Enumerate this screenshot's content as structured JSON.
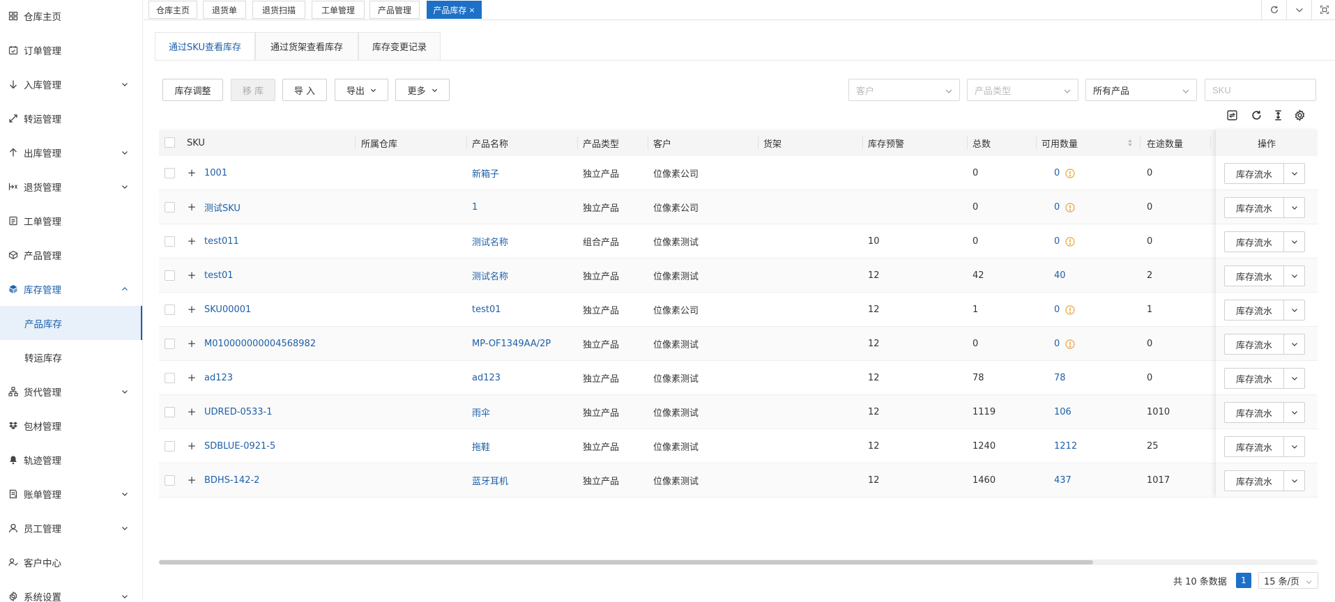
{
  "sidebar": {
    "items": [
      {
        "label": "仓库主页",
        "icon": "grid-icon",
        "chevron": false
      },
      {
        "label": "订单管理",
        "icon": "calendar-icon",
        "chevron": false
      },
      {
        "label": "入库管理",
        "icon": "arrow-down-icon",
        "chevron": true
      },
      {
        "label": "转运管理",
        "icon": "transfer-icon",
        "chevron": false
      },
      {
        "label": "出库管理",
        "icon": "arrow-up-icon",
        "chevron": true
      },
      {
        "label": "退货管理",
        "icon": "return-icon",
        "chevron": true
      },
      {
        "label": "工单管理",
        "icon": "ticket-icon",
        "chevron": false
      },
      {
        "label": "产品管理",
        "icon": "box-icon",
        "chevron": false
      },
      {
        "label": "库存管理",
        "icon": "inventory-icon",
        "chevron": true
      }
    ],
    "sub_items": [
      {
        "label": "产品库存"
      },
      {
        "label": "转运库存"
      }
    ],
    "items_after": [
      {
        "label": "货代管理",
        "icon": "hierarchy-icon",
        "chevron": true
      },
      {
        "label": "包材管理",
        "icon": "dropbox-icon",
        "chevron": false
      },
      {
        "label": "轨迹管理",
        "icon": "bell-icon",
        "chevron": false
      },
      {
        "label": "账单管理",
        "icon": "bill-icon",
        "chevron": true
      },
      {
        "label": "员工管理",
        "icon": "user-icon",
        "chevron": true
      },
      {
        "label": "客户中心",
        "icon": "customer-icon",
        "chevron": false
      },
      {
        "label": "系统设置",
        "icon": "settings-icon",
        "chevron": true
      }
    ]
  },
  "top_tabs": [
    "仓库主页",
    "退货单",
    "退货扫描",
    "工单管理",
    "产品管理",
    "产品库存"
  ],
  "top_tab_close": "×",
  "content_tabs": [
    "通过SKU查看库存",
    "通过货架查看库存",
    "库存变更记录"
  ],
  "toolbar": {
    "adjust": "库存调整",
    "move": "移 库",
    "import": "导 入",
    "export": "导出",
    "more": "更多"
  },
  "filters": {
    "customer": "客户",
    "product_type": "产品类型",
    "product_scope": "所有产品",
    "sku_placeholder": "SKU"
  },
  "table": {
    "headers": {
      "sku": "SKU",
      "warehouse": "所属仓库",
      "name": "产品名称",
      "type": "产品类型",
      "customer": "客户",
      "shelf": "货架",
      "warning": "库存预警",
      "total": "总数",
      "available": "可用数量",
      "transit": "在途数量",
      "op": "操作"
    },
    "rows": [
      {
        "sku": "1001",
        "warehouse": "",
        "name": "新箱子",
        "type": "独立产品",
        "customer": "位像素公司",
        "shelf": "",
        "warning": "",
        "total": "0",
        "available": "0",
        "available_warn": true,
        "transit": "0"
      },
      {
        "sku": "测试SKU",
        "warehouse": "",
        "name": "1",
        "type": "独立产品",
        "customer": "位像素公司",
        "shelf": "",
        "warning": "",
        "total": "0",
        "available": "0",
        "available_warn": true,
        "transit": "0"
      },
      {
        "sku": "test011",
        "warehouse": "",
        "name": "测试名称",
        "type": "组合产品",
        "customer": "位像素测试",
        "shelf": "",
        "warning": "10",
        "total": "0",
        "available": "0",
        "available_warn": true,
        "transit": "0"
      },
      {
        "sku": "test01",
        "warehouse": "",
        "name": "测试名称",
        "type": "独立产品",
        "customer": "位像素测试",
        "shelf": "",
        "warning": "12",
        "total": "42",
        "available": "40",
        "available_warn": false,
        "transit": "2"
      },
      {
        "sku": "SKU00001",
        "warehouse": "",
        "name": "test01",
        "type": "独立产品",
        "customer": "位像素公司",
        "shelf": "",
        "warning": "12",
        "total": "1",
        "available": "0",
        "available_warn": true,
        "transit": "1"
      },
      {
        "sku": "M010000000004568982",
        "warehouse": "",
        "name": "MP-OF1349AA/2P",
        "type": "独立产品",
        "customer": "位像素测试",
        "shelf": "",
        "warning": "12",
        "total": "0",
        "available": "0",
        "available_warn": true,
        "transit": "0"
      },
      {
        "sku": "ad123",
        "warehouse": "",
        "name": "ad123",
        "type": "独立产品",
        "customer": "位像素测试",
        "shelf": "",
        "warning": "12",
        "total": "78",
        "available": "78",
        "available_warn": false,
        "transit": "0"
      },
      {
        "sku": "UDRED-0533-1",
        "warehouse": "",
        "name": "雨伞",
        "type": "独立产品",
        "customer": "位像素测试",
        "shelf": "",
        "warning": "12",
        "total": "1119",
        "available": "106",
        "available_warn": false,
        "transit": "1010"
      },
      {
        "sku": "SDBLUE-0921-5",
        "warehouse": "",
        "name": "拖鞋",
        "type": "独立产品",
        "customer": "位像素测试",
        "shelf": "",
        "warning": "12",
        "total": "1240",
        "available": "1212",
        "available_warn": false,
        "transit": "25"
      },
      {
        "sku": "BDHS-142-2",
        "warehouse": "",
        "name": "蓝牙耳机",
        "type": "独立产品",
        "customer": "位像素测试",
        "shelf": "",
        "warning": "12",
        "total": "1460",
        "available": "437",
        "available_warn": false,
        "transit": "1017"
      }
    ],
    "op_label": "库存流水"
  },
  "pager": {
    "total_text": "共 10 条数据",
    "current_page": "1",
    "page_size": "15 条/页"
  },
  "colors": {
    "accent": "#1e6fc6",
    "link": "#1e5fa8",
    "warn": "#e6a23c"
  }
}
